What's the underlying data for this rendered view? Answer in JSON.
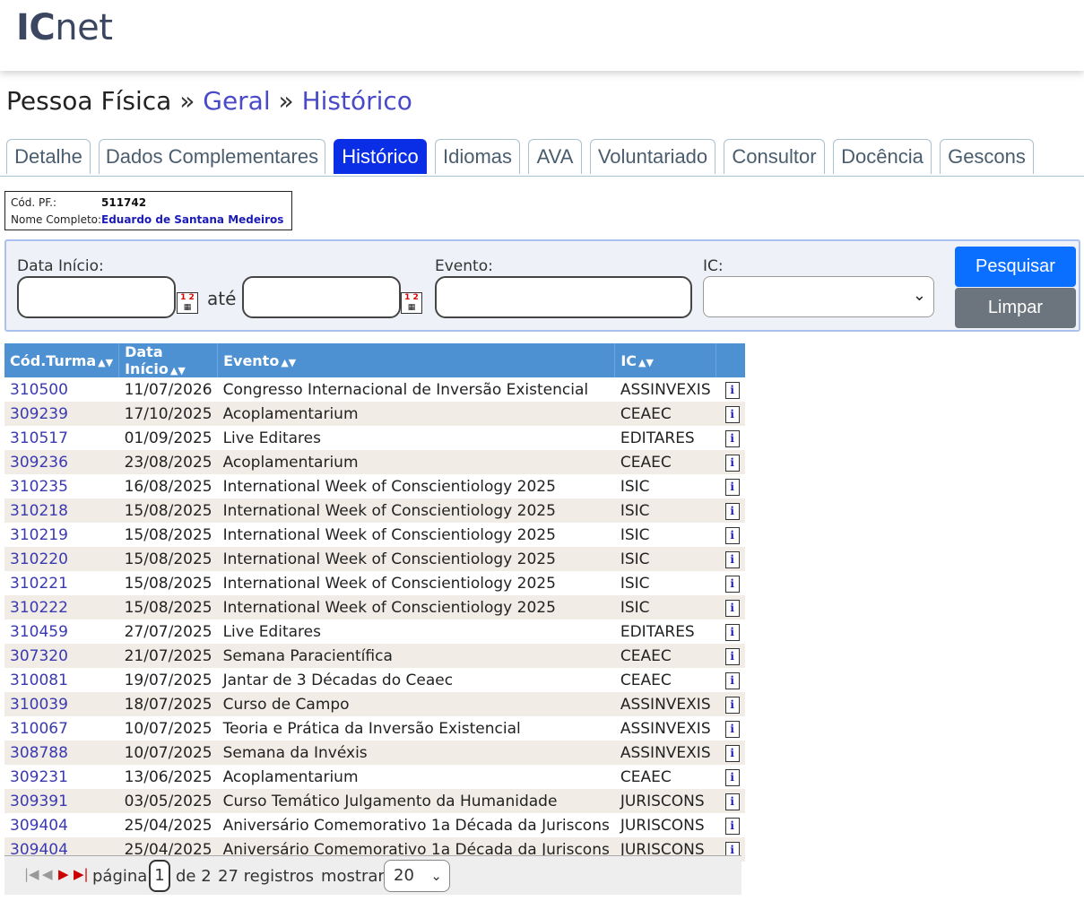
{
  "logo": {
    "ic": "IC",
    "net": "net"
  },
  "breadcrumb": {
    "root": "Pessoa Física",
    "sep": "»",
    "level1": "Geral",
    "level2": "Histórico"
  },
  "tabs": [
    "Detalhe",
    "Dados Complementares",
    "Histórico",
    "Idiomas",
    "AVA",
    "Voluntariado",
    "Consultor",
    "Docência",
    "Gescons"
  ],
  "active_tab": "Histórico",
  "person": {
    "cod_label": "Cód. PF.:",
    "cod_value": "511742",
    "name_label": "Nome Completo:",
    "name_value": "Eduardo de Santana Medeiros"
  },
  "filter": {
    "data_inicio_label": "Data Início:",
    "ate_label": "até",
    "evento_label": "Evento:",
    "ic_label": "IC:",
    "data_inicio_value": "",
    "data_fim_value": "",
    "evento_value": "",
    "ic_value": "",
    "calendar_icon": "calendar-icon",
    "search_button": "Pesquisar",
    "clear_button": "Limpar"
  },
  "table": {
    "columns": [
      "Cód.Turma",
      "Data Início",
      "Evento",
      "IC"
    ],
    "rows": [
      {
        "code": "310500",
        "date": "11/07/2026",
        "event": "Congresso Internacional de Inversão Existencial",
        "ic": "ASSINVEXIS"
      },
      {
        "code": "309239",
        "date": "17/10/2025",
        "event": "Acoplamentarium",
        "ic": "CEAEC"
      },
      {
        "code": "310517",
        "date": "01/09/2025",
        "event": "Live Editares",
        "ic": "EDITARES"
      },
      {
        "code": "309236",
        "date": "23/08/2025",
        "event": "Acoplamentarium",
        "ic": "CEAEC"
      },
      {
        "code": "310235",
        "date": "16/08/2025",
        "event": "International Week of Conscientiology 2025",
        "ic": "ISIC"
      },
      {
        "code": "310218",
        "date": "15/08/2025",
        "event": "International Week of Conscientiology 2025",
        "ic": "ISIC"
      },
      {
        "code": "310219",
        "date": "15/08/2025",
        "event": "International Week of Conscientiology 2025",
        "ic": "ISIC"
      },
      {
        "code": "310220",
        "date": "15/08/2025",
        "event": "International Week of Conscientiology 2025",
        "ic": "ISIC"
      },
      {
        "code": "310221",
        "date": "15/08/2025",
        "event": "International Week of Conscientiology 2025",
        "ic": "ISIC"
      },
      {
        "code": "310222",
        "date": "15/08/2025",
        "event": "International Week of Conscientiology 2025",
        "ic": "ISIC"
      },
      {
        "code": "310459",
        "date": "27/07/2025",
        "event": "Live Editares",
        "ic": "EDITARES"
      },
      {
        "code": "307320",
        "date": "21/07/2025",
        "event": "Semana Paracientífica",
        "ic": "CEAEC"
      },
      {
        "code": "310081",
        "date": "19/07/2025",
        "event": "Jantar de 3 Décadas do Ceaec",
        "ic": "CEAEC"
      },
      {
        "code": "310039",
        "date": "18/07/2025",
        "event": "Curso de Campo",
        "ic": "ASSINVEXIS"
      },
      {
        "code": "310067",
        "date": "10/07/2025",
        "event": "Teoria e Prática da Inversão Existencial",
        "ic": "ASSINVEXIS"
      },
      {
        "code": "308788",
        "date": "10/07/2025",
        "event": "Semana da Invéxis",
        "ic": "ASSINVEXIS"
      },
      {
        "code": "309231",
        "date": "13/06/2025",
        "event": "Acoplamentarium",
        "ic": "CEAEC"
      },
      {
        "code": "309391",
        "date": "03/05/2025",
        "event": "Curso Temático Julgamento da Humanidade",
        "ic": "JURISCONS"
      },
      {
        "code": "309404",
        "date": "25/04/2025",
        "event": "Aniversário Comemorativo 1a Década da Juriscons",
        "ic": "JURISCONS"
      },
      {
        "code": "309404",
        "date": "25/04/2025",
        "event": "Aniversário Comemorativo 1a Década da Juriscons",
        "ic": "JURISCONS"
      }
    ]
  },
  "pager": {
    "page_label": "página",
    "current_page": "1",
    "of_label": "de 2",
    "records": "27 registros",
    "show_label": "mostrar",
    "page_size": "20"
  },
  "colors": {
    "tab_active": "#0a2ee6",
    "header_blue": "#4d91d3",
    "primary_button": "#0a6fff",
    "secondary_button": "#6c757d",
    "link": "#3a3ab0"
  }
}
